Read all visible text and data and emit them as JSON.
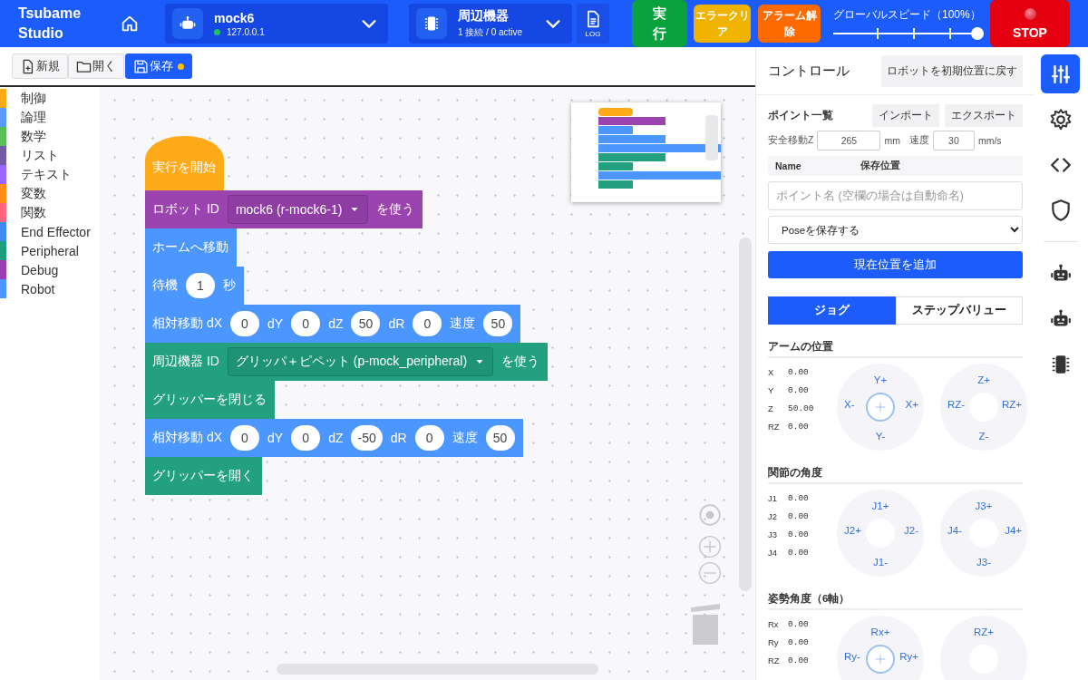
{
  "header": {
    "app_name": "Tsubame Studio",
    "robot": {
      "name": "mock6",
      "address": "127.0.0.1",
      "connected": true
    },
    "peripheral": {
      "title": "周辺機器",
      "status": "1 接続 / 0 active"
    },
    "log_label": "LOG",
    "actions": [
      {
        "label": "実行",
        "kind": "run"
      },
      {
        "label": "エラークリア",
        "kind": "clear"
      },
      {
        "label": "アラーム解除",
        "kind": "alarm"
      }
    ],
    "speed": {
      "label": "グローバルスピード（100%）",
      "level": 1
    },
    "stop_label": "STOP"
  },
  "toolbar": [
    {
      "label": "新規",
      "kind": "new",
      "primary": false,
      "unsaved": false
    },
    {
      "label": "開く",
      "kind": "open",
      "primary": false,
      "unsaved": false
    },
    {
      "label": "保存",
      "kind": "save",
      "primary": true,
      "unsaved": true
    }
  ],
  "categories": [
    {
      "label": "制御",
      "color": "#ffab19"
    },
    {
      "label": "論理",
      "color": "#5b9bf5"
    },
    {
      "label": "数学",
      "color": "#59c059"
    },
    {
      "label": "リスト",
      "color": "#745ba5"
    },
    {
      "label": "テキスト",
      "color": "#9966ff"
    },
    {
      "label": "変数",
      "color": "#ff8c1a"
    },
    {
      "label": "関数",
      "color": "#ff6680"
    },
    {
      "label": "End Effector",
      "color": "#3d8bf0"
    },
    {
      "label": "Peripheral",
      "color": "#1f9e7e"
    },
    {
      "label": "Debug",
      "color": "#9a3fb0"
    },
    {
      "label": "Robot",
      "color": "#4c97ff"
    }
  ],
  "blocks": [
    {
      "kind": "hat",
      "color": "#ffab19",
      "parts": [
        {
          "kind": "label",
          "text": "実行を開始"
        }
      ]
    },
    {
      "kind": "stack",
      "color": "#9b44b0",
      "parts": [
        {
          "kind": "label",
          "text": "ロボット ID"
        },
        {
          "kind": "dropdown",
          "text": "mock6 (r-mock6-1)"
        },
        {
          "kind": "label",
          "text": "を使う"
        }
      ]
    },
    {
      "kind": "stack",
      "color": "#4c97ff",
      "parts": [
        {
          "kind": "label",
          "text": "ホームへ移動"
        }
      ]
    },
    {
      "kind": "stack",
      "color": "#4c97ff",
      "parts": [
        {
          "kind": "label",
          "text": "待機"
        },
        {
          "kind": "number",
          "text": "1"
        },
        {
          "kind": "label",
          "text": "秒"
        }
      ]
    },
    {
      "kind": "stack",
      "color": "#4c97ff",
      "parts": [
        {
          "kind": "label",
          "text": "相対移動 dX"
        },
        {
          "kind": "number",
          "text": "0"
        },
        {
          "kind": "label",
          "text": "dY"
        },
        {
          "kind": "number",
          "text": "0"
        },
        {
          "kind": "label",
          "text": "dZ"
        },
        {
          "kind": "number",
          "text": "50"
        },
        {
          "kind": "label",
          "text": "dR"
        },
        {
          "kind": "number",
          "text": "0"
        },
        {
          "kind": "label",
          "text": "速度"
        },
        {
          "kind": "number",
          "text": "50"
        }
      ]
    },
    {
      "kind": "stack",
      "color": "#22a07f",
      "parts": [
        {
          "kind": "label",
          "text": "周辺機器 ID"
        },
        {
          "kind": "dropdown",
          "text": "グリッパ＋ピペット (p-mock_peripheral)"
        },
        {
          "kind": "label",
          "text": "を使う"
        }
      ]
    },
    {
      "kind": "stack",
      "color": "#22a07f",
      "parts": [
        {
          "kind": "label",
          "text": "グリッパーを閉じる"
        }
      ]
    },
    {
      "kind": "stack",
      "color": "#4c97ff",
      "parts": [
        {
          "kind": "label",
          "text": "相対移動 dX"
        },
        {
          "kind": "number",
          "text": "0"
        },
        {
          "kind": "label",
          "text": "dY"
        },
        {
          "kind": "number",
          "text": "0"
        },
        {
          "kind": "label",
          "text": "dZ"
        },
        {
          "kind": "number",
          "text": "-50"
        },
        {
          "kind": "label",
          "text": "dR"
        },
        {
          "kind": "number",
          "text": "0"
        },
        {
          "kind": "label",
          "text": "速度"
        },
        {
          "kind": "number",
          "text": "50"
        }
      ]
    },
    {
      "kind": "stack",
      "color": "#22a07f",
      "parts": [
        {
          "kind": "label",
          "text": "グリッパーを開く"
        }
      ]
    }
  ],
  "control": {
    "title": "コントロール",
    "reset_button": "ロボットを初期位置に戻す",
    "points": {
      "title": "ポイント一覧",
      "import_button": "インポート",
      "export_button": "エクスポート",
      "safe_z_label": "安全移動Z",
      "safe_z": "265",
      "safe_z_unit": "mm",
      "speed_label": "速度",
      "speed": "30",
      "speed_unit": "mm/s",
      "columns": [
        "Name",
        "保存位置"
      ],
      "name_placeholder": "ポイント名 (空欄の場合は自動命名)",
      "pose_select": "Poseを保存する",
      "add_button": "現在位置を追加"
    },
    "mode_tabs": [
      {
        "label": "ジョグ",
        "selected": true
      },
      {
        "label": "ステップバリュー",
        "selected": false
      }
    ],
    "sections": [
      {
        "title": "アームの位置",
        "readings": [
          {
            "label": "X",
            "value": "0.00"
          },
          {
            "label": "Y",
            "value": "0.00"
          },
          {
            "label": "Z",
            "value": "50.00"
          },
          {
            "label": "RZ",
            "value": "0.00"
          }
        ],
        "pads": [
          {
            "up": "Y+",
            "left": "X-",
            "right": "X+",
            "down": "Y-",
            "center_active": true
          },
          {
            "up": "Z+",
            "left": "RZ-",
            "right": "RZ+",
            "down": "Z-",
            "center_active": false
          }
        ]
      },
      {
        "title": "関節の角度",
        "readings": [
          {
            "label": "J1",
            "value": "0.00"
          },
          {
            "label": "J2",
            "value": "0.00"
          },
          {
            "label": "J3",
            "value": "0.00"
          },
          {
            "label": "J4",
            "value": "0.00"
          }
        ],
        "pads": [
          {
            "up": "J1+",
            "left": "J2+",
            "right": "J2-",
            "down": "J1-",
            "center_active": false
          },
          {
            "up": "J3+",
            "left": "J4-",
            "right": "J4+",
            "down": "J3-",
            "center_active": false
          }
        ]
      },
      {
        "title": "姿勢角度（6軸）",
        "readings": [
          {
            "label": "Rx",
            "value": "0.00"
          },
          {
            "label": "Ry",
            "value": "0.00"
          },
          {
            "label": "RZ",
            "value": "0.00"
          }
        ],
        "pads": [
          {
            "up": "Rx+",
            "left": "Ry-",
            "right": "Ry+",
            "center_active": true
          },
          {
            "up": "RZ+",
            "center_active": false
          }
        ]
      }
    ]
  },
  "rail": [
    {
      "kind": "sliders",
      "selected": true
    },
    {
      "kind": "gear",
      "selected": false
    },
    {
      "kind": "code",
      "selected": false
    },
    {
      "kind": "shield",
      "selected": false
    },
    {
      "kind": "robot",
      "selected": false
    },
    {
      "kind": "robot",
      "selected": false
    },
    {
      "kind": "chip",
      "selected": false
    }
  ]
}
